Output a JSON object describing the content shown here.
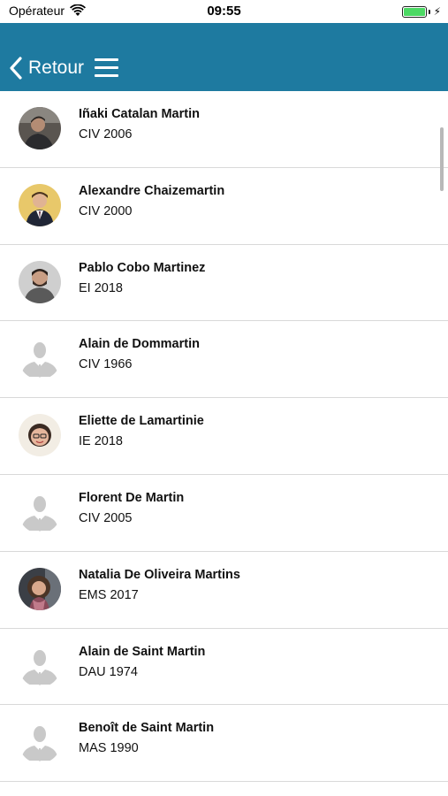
{
  "status": {
    "carrier": "Opérateur",
    "time": "09:55"
  },
  "nav": {
    "back_label": "Retour"
  },
  "colors": {
    "navbar": "#1e7aa0",
    "battery": "#4cd964"
  },
  "people": [
    {
      "name": "Iñaki Catalan Martin",
      "subtitle": "CIV 2006",
      "avatar": "photo"
    },
    {
      "name": "Alexandre Chaizemartin",
      "subtitle": "CIV 2000",
      "avatar": "photo"
    },
    {
      "name": "Pablo Cobo Martinez",
      "subtitle": "EI 2018",
      "avatar": "photo"
    },
    {
      "name": "Alain de Dommartin",
      "subtitle": "CIV 1966",
      "avatar": "placeholder"
    },
    {
      "name": "Eliette de Lamartinie",
      "subtitle": "IE 2018",
      "avatar": "photo"
    },
    {
      "name": "Florent De Martin",
      "subtitle": "CIV 2005",
      "avatar": "placeholder"
    },
    {
      "name": "Natalia De Oliveira Martins",
      "subtitle": "EMS 2017",
      "avatar": "photo"
    },
    {
      "name": "Alain de Saint Martin",
      "subtitle": "DAU 1974",
      "avatar": "placeholder"
    },
    {
      "name": "Benoît de Saint Martin",
      "subtitle": "MAS 1990",
      "avatar": "placeholder"
    }
  ]
}
